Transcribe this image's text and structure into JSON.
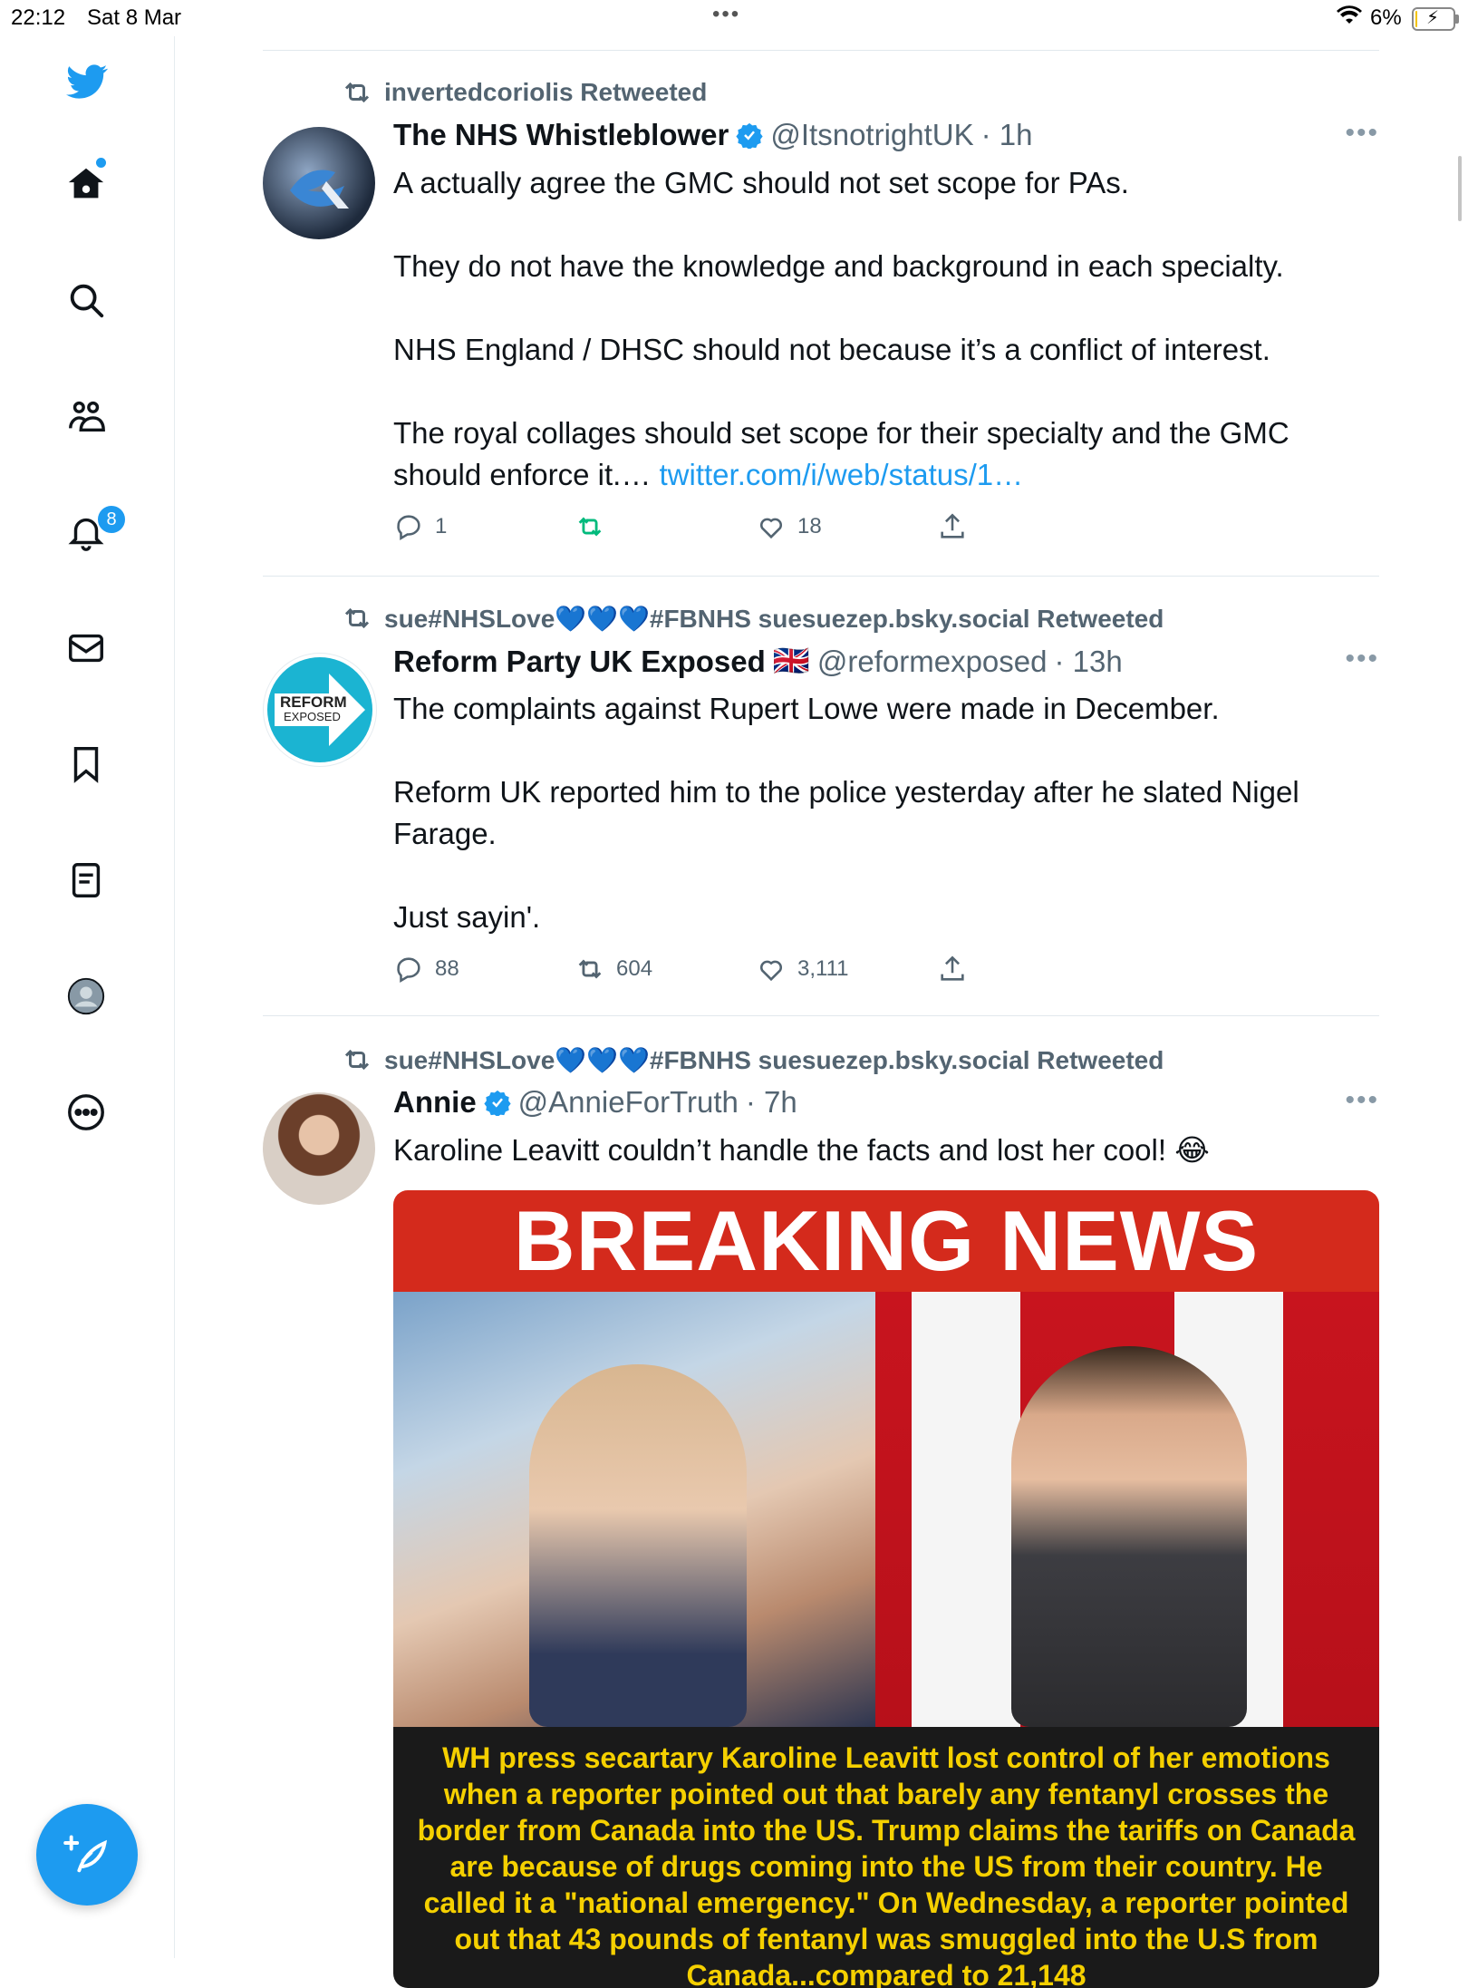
{
  "status_bar": {
    "time": "22:12",
    "date": "Sat 8 Mar",
    "dots": "•••",
    "battery": "6%",
    "battery_level": 0.06
  },
  "sidebar": {
    "items": [
      {
        "name": "home",
        "icon": "home-icon"
      },
      {
        "name": "explore",
        "icon": "search-icon"
      },
      {
        "name": "communities",
        "icon": "communities-icon"
      },
      {
        "name": "notifications",
        "icon": "bell-icon",
        "badge": "8"
      },
      {
        "name": "messages",
        "icon": "mail-icon"
      },
      {
        "name": "bookmarks",
        "icon": "bookmark-icon"
      },
      {
        "name": "lists",
        "icon": "list-icon"
      },
      {
        "name": "profile",
        "icon": "avatar-icon"
      },
      {
        "name": "more",
        "icon": "more-circle-icon"
      }
    ],
    "notification_badge": "8",
    "compose_icon": "compose-feather-icon"
  },
  "tweets": [
    {
      "retweeted_by": "invertedcoriolis Retweeted",
      "name": "The NHS Whistleblower",
      "handle": "@ItsnotrightUK",
      "time": "· 1h",
      "text": "A actually agree the GMC should not set scope for PAs.\n\nThey do not have the knowledge and background in each specialty.\n\nNHS England / DHSC should not because it’s a conflict of interest.\n\nThe royal collages should set scope for their specialty and the GMC should enforce it.… ",
      "link": "twitter.com/i/web/status/1…",
      "replies": "1",
      "retweets": "",
      "likes": "18"
    },
    {
      "retweeted_by": "sue#NHSLove💙💙💙#FBNHS suesuezep.bsky.social Retweeted",
      "name": "Reform Party UK Exposed",
      "flag": "🇬🇧",
      "handle": "@reformexposed",
      "time": "· 13h",
      "text": "The complaints against Rupert Lowe were made in December.\n\nReform UK reported him to the police yesterday after he slated Nigel Farage.\n\nJust sayin'.",
      "avatar_text_1": "REFORM",
      "avatar_text_2": "EXPOSED",
      "replies": "88",
      "retweets": "604",
      "likes": "3,111"
    },
    {
      "retweeted_by": "sue#NHSLove💙💙💙#FBNHS suesuezep.bsky.social Retweeted",
      "name": "Annie",
      "handle": "@AnnieForTruth",
      "time": "· 7h",
      "text": "Karoline Leavitt couldn’t handle the facts and lost her cool! 😂",
      "media": {
        "banner": "BREAKING NEWS",
        "caption": "WH press secartary Karoline Leavitt lost control of her emotions when a reporter pointed out that barely any fentanyl crosses the border from Canada into the US. Trump claims the tariffs on Canada are because of drugs coming into the US from their country. He called it a \"national emergency.\" On Wednesday, a reporter pointed out that 43 pounds of fentanyl was smuggled into the U.S from Canada...compared to 21,148"
      }
    }
  ],
  "colors": {
    "accent": "#1d9bf0",
    "retweet_green": "#00ba7c",
    "secondary_text": "#536471",
    "banner_red": "#d42a1c",
    "caption_yellow": "#f5d000"
  }
}
